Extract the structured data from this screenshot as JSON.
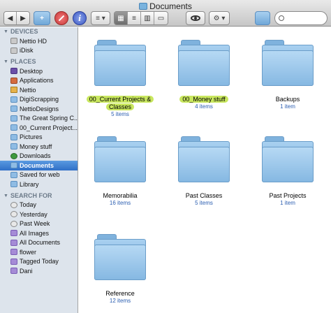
{
  "window": {
    "title": "Documents"
  },
  "toolbar": {
    "back_glyph": "◀",
    "forward_glyph": "▶",
    "new_folder_glyph": "+",
    "info_glyph": "i",
    "list_glyph": "≡ ▾",
    "eye_glyph": "👁",
    "gear_glyph": "⚙ ▾",
    "views": [
      "▦",
      "≡",
      "▥",
      "▭"
    ]
  },
  "sidebar": {
    "sections": [
      {
        "title": "DEVICES",
        "items": [
          {
            "label": "Nettio HD",
            "icon": "disk"
          },
          {
            "label": "iDisk",
            "icon": "disk"
          }
        ]
      },
      {
        "title": "PLACES",
        "items": [
          {
            "label": "Desktop",
            "icon": "desk"
          },
          {
            "label": "Applications",
            "icon": "app"
          },
          {
            "label": "Nettio",
            "icon": "home"
          },
          {
            "label": "DigiScrapping",
            "icon": "folder"
          },
          {
            "label": "NettioDesigns",
            "icon": "folder"
          },
          {
            "label": "The Great Spring C...",
            "icon": "folder"
          },
          {
            "label": "00_Current Project...",
            "icon": "folder"
          },
          {
            "label": "Pictures",
            "icon": "folder"
          },
          {
            "label": "Money stuff",
            "icon": "folder"
          },
          {
            "label": "Downloads",
            "icon": "dl"
          },
          {
            "label": "Documents",
            "icon": "folder",
            "selected": true
          },
          {
            "label": "Saved for web",
            "icon": "folder"
          },
          {
            "label": "Library",
            "icon": "folder"
          }
        ]
      },
      {
        "title": "SEARCH FOR",
        "items": [
          {
            "label": "Today",
            "icon": "clock"
          },
          {
            "label": "Yesterday",
            "icon": "clock"
          },
          {
            "label": "Past Week",
            "icon": "clock"
          },
          {
            "label": "All Images",
            "icon": "smart"
          },
          {
            "label": "All Documents",
            "icon": "smart"
          },
          {
            "label": "flower",
            "icon": "smart"
          },
          {
            "label": "Tagged Today",
            "icon": "smart"
          },
          {
            "label": "Dani",
            "icon": "smart"
          }
        ]
      }
    ]
  },
  "folders": [
    {
      "name": "00_Current Projects & Classes",
      "count": "5 items",
      "highlight": true
    },
    {
      "name": "00_Money stuff",
      "count": "4 items",
      "highlight": true
    },
    {
      "name": "Backups",
      "count": "1 item",
      "highlight": false
    },
    {
      "name": "Memorabilia",
      "count": "16 items",
      "highlight": false
    },
    {
      "name": "Past Classes",
      "count": "5 items",
      "highlight": false
    },
    {
      "name": "Past Projects",
      "count": "1 item",
      "highlight": false
    },
    {
      "name": "Reference",
      "count": "12 items",
      "highlight": false
    }
  ],
  "colors": {
    "highlight": "#c9e75f",
    "selection": "#3677cc",
    "count_text": "#2a5db0"
  }
}
